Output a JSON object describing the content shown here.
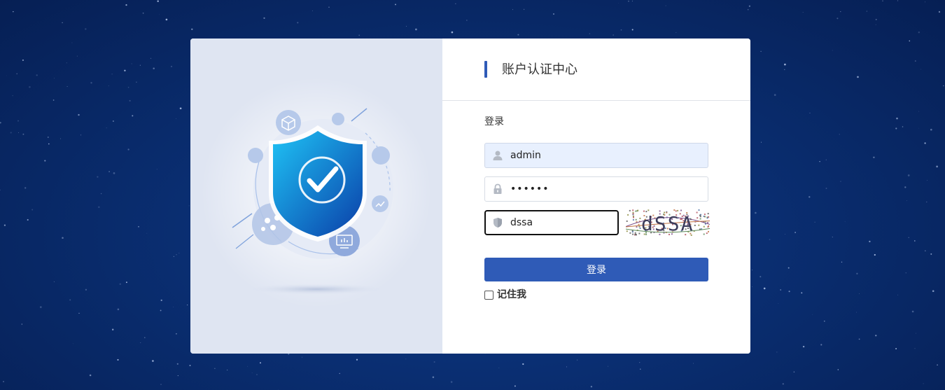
{
  "header": {
    "title": "账户认证中心"
  },
  "form": {
    "section_label": "登录",
    "username": {
      "value": "admin",
      "icon": "user-icon"
    },
    "password": {
      "value": "••••••",
      "icon": "lock-icon"
    },
    "captcha": {
      "value": "dssa",
      "icon": "shield-icon",
      "image_text": "dSSA"
    },
    "submit_label": "登录",
    "remember_label": "记住我",
    "remember_checked": false
  },
  "colors": {
    "accent": "#2f5bb7",
    "background": "#0a2f73"
  }
}
